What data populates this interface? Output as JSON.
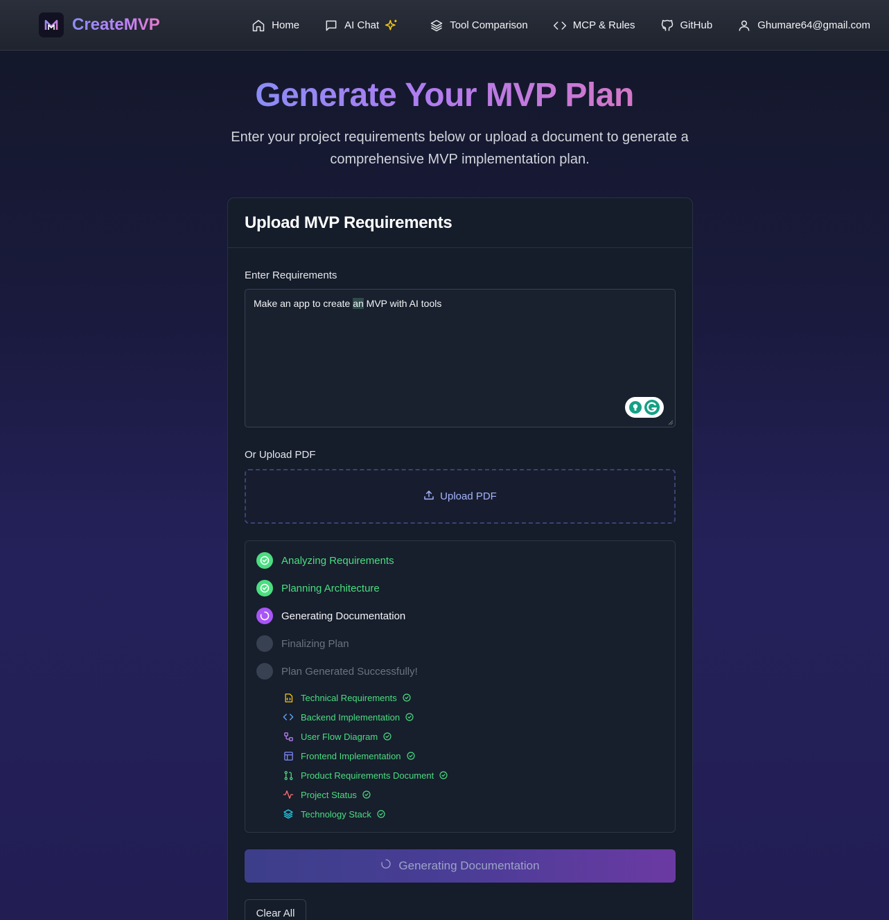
{
  "brand": {
    "name": "CreateMVP"
  },
  "nav": {
    "home": "Home",
    "ai_chat": "AI Chat",
    "tool_comparison": "Tool Comparison",
    "mcp_rules": "MCP & Rules",
    "github": "GitHub",
    "user": "Ghumare64@gmail.com"
  },
  "hero": {
    "title": "Generate Your MVP Plan",
    "subtitle": "Enter your project requirements below or upload a document to generate a comprehensive MVP implementation plan."
  },
  "card": {
    "title": "Upload MVP Requirements",
    "requirements_label": "Enter Requirements",
    "requirements_value_before": "Make an app to create ",
    "requirements_value_highlight": "an",
    "requirements_value_after": " MVP with AI tools",
    "upload_label": "Or Upload PDF",
    "upload_button": "Upload PDF"
  },
  "steps": [
    {
      "label": "Analyzing Requirements",
      "status": "done"
    },
    {
      "label": "Planning Architecture",
      "status": "done"
    },
    {
      "label": "Generating Documentation",
      "status": "active"
    },
    {
      "label": "Finalizing Plan",
      "status": "pending"
    },
    {
      "label": "Plan Generated Successfully!",
      "status": "pending"
    }
  ],
  "documents": [
    {
      "label": "Technical Requirements",
      "icon": "file-code-icon"
    },
    {
      "label": "Backend Implementation",
      "icon": "code-icon"
    },
    {
      "label": "User Flow Diagram",
      "icon": "workflow-icon"
    },
    {
      "label": "Frontend Implementation",
      "icon": "layout-icon"
    },
    {
      "label": "Product Requirements Document",
      "icon": "git-pull-request-icon"
    },
    {
      "label": "Project Status",
      "icon": "activity-icon"
    },
    {
      "label": "Technology Stack",
      "icon": "layers-icon"
    }
  ],
  "actions": {
    "generate": "Generating Documentation",
    "clear": "Clear All"
  },
  "colors": {
    "accent_purple": "#a855f7",
    "success_green": "#4ade80",
    "pending_gray": "#374151"
  }
}
